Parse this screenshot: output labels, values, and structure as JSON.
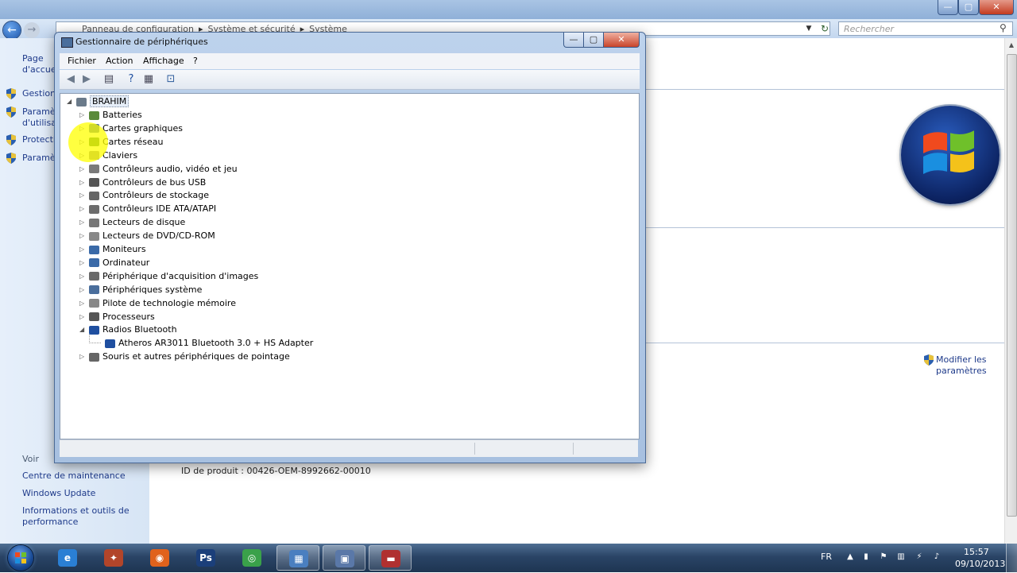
{
  "background_window": {
    "address_crumbs": [
      "Panneau de configuration",
      "Système et sécurité",
      "Système"
    ],
    "search_placeholder": "Rechercher",
    "sidebar": {
      "top_links": [
        "Page d'accueil du panneau de configuration"
      ],
      "task_links": [
        "Gestionnaire de périphériques",
        "Paramètres d'utilisation à distance",
        "Protection du système",
        "Paramètres système avancés"
      ],
      "see_also_header": "Voir aussi",
      "see_also_links": [
        "Centre de maintenance",
        "Windows Update",
        "Informations et outils de performance"
      ]
    },
    "product_id_label": "ID de produit :",
    "product_id_value": "00426-OEM-8992662-00010",
    "modify_link_lines": [
      "Modifier les",
      "paramètres"
    ]
  },
  "device_manager": {
    "title": "Gestionnaire de périphériques",
    "menu": [
      "Fichier",
      "Action",
      "Affichage",
      "?"
    ],
    "toolbar": [
      "back-icon",
      "forward-icon",
      "properties-view-icon",
      "help-icon",
      "details-view-icon",
      "scan-hardware-icon"
    ],
    "root": "BRAHIM",
    "categories": [
      {
        "label": "Batteries",
        "color": "#5a8a3a"
      },
      {
        "label": "Cartes graphiques",
        "color": "#4a6e9c"
      },
      {
        "label": "Cartes réseau",
        "color": "#3f7b3f"
      },
      {
        "label": "Claviers",
        "color": "#8a8a8a"
      },
      {
        "label": "Contrôleurs audio, vidéo et jeu",
        "color": "#7a7a7a"
      },
      {
        "label": "Contrôleurs de bus USB",
        "color": "#555555"
      },
      {
        "label": "Contrôleurs de stockage",
        "color": "#666666"
      },
      {
        "label": "Contrôleurs IDE ATA/ATAPI",
        "color": "#6d6d6d"
      },
      {
        "label": "Lecteurs de disque",
        "color": "#777777"
      },
      {
        "label": "Lecteurs de DVD/CD-ROM",
        "color": "#888888"
      },
      {
        "label": "Moniteurs",
        "color": "#3a6aa8"
      },
      {
        "label": "Ordinateur",
        "color": "#3a6aa8"
      },
      {
        "label": "Périphérique d'acquisition d'images",
        "color": "#6a6a6a"
      },
      {
        "label": "Périphériques système",
        "color": "#4a6e9c"
      },
      {
        "label": "Pilote de technologie mémoire",
        "color": "#888888"
      },
      {
        "label": "Processeurs",
        "color": "#555555"
      },
      {
        "label": "Radios Bluetooth",
        "color": "#1f4fa0"
      },
      {
        "label": "Souris et autres périphériques de pointage",
        "color": "#666666"
      }
    ],
    "expanded_child": {
      "label": "Atheros AR3011 Bluetooth 3.0 + HS Adapter",
      "color": "#1f4fa0"
    }
  },
  "taskbar": {
    "apps": [
      {
        "name": "internet-explorer-icon",
        "glyph": "e",
        "color": "#2a7fd4"
      },
      {
        "name": "game-app-icon",
        "glyph": "✦",
        "color": "#b2452a"
      },
      {
        "name": "firefox-icon",
        "glyph": "◉",
        "color": "#e0621c"
      },
      {
        "name": "photoshop-icon",
        "glyph": "Ps",
        "color": "#1b3f7a"
      },
      {
        "name": "chrome-icon",
        "glyph": "◎",
        "color": "#3aa14a"
      },
      {
        "name": "control-panel-icon",
        "glyph": "▦",
        "color": "#4a7fc0"
      },
      {
        "name": "device-manager-icon",
        "glyph": "▣",
        "color": "#5a78a8"
      },
      {
        "name": "toolbox-icon",
        "glyph": "▬",
        "color": "#b03030"
      }
    ],
    "language": "FR",
    "time": "15:57",
    "date": "09/10/2013"
  }
}
